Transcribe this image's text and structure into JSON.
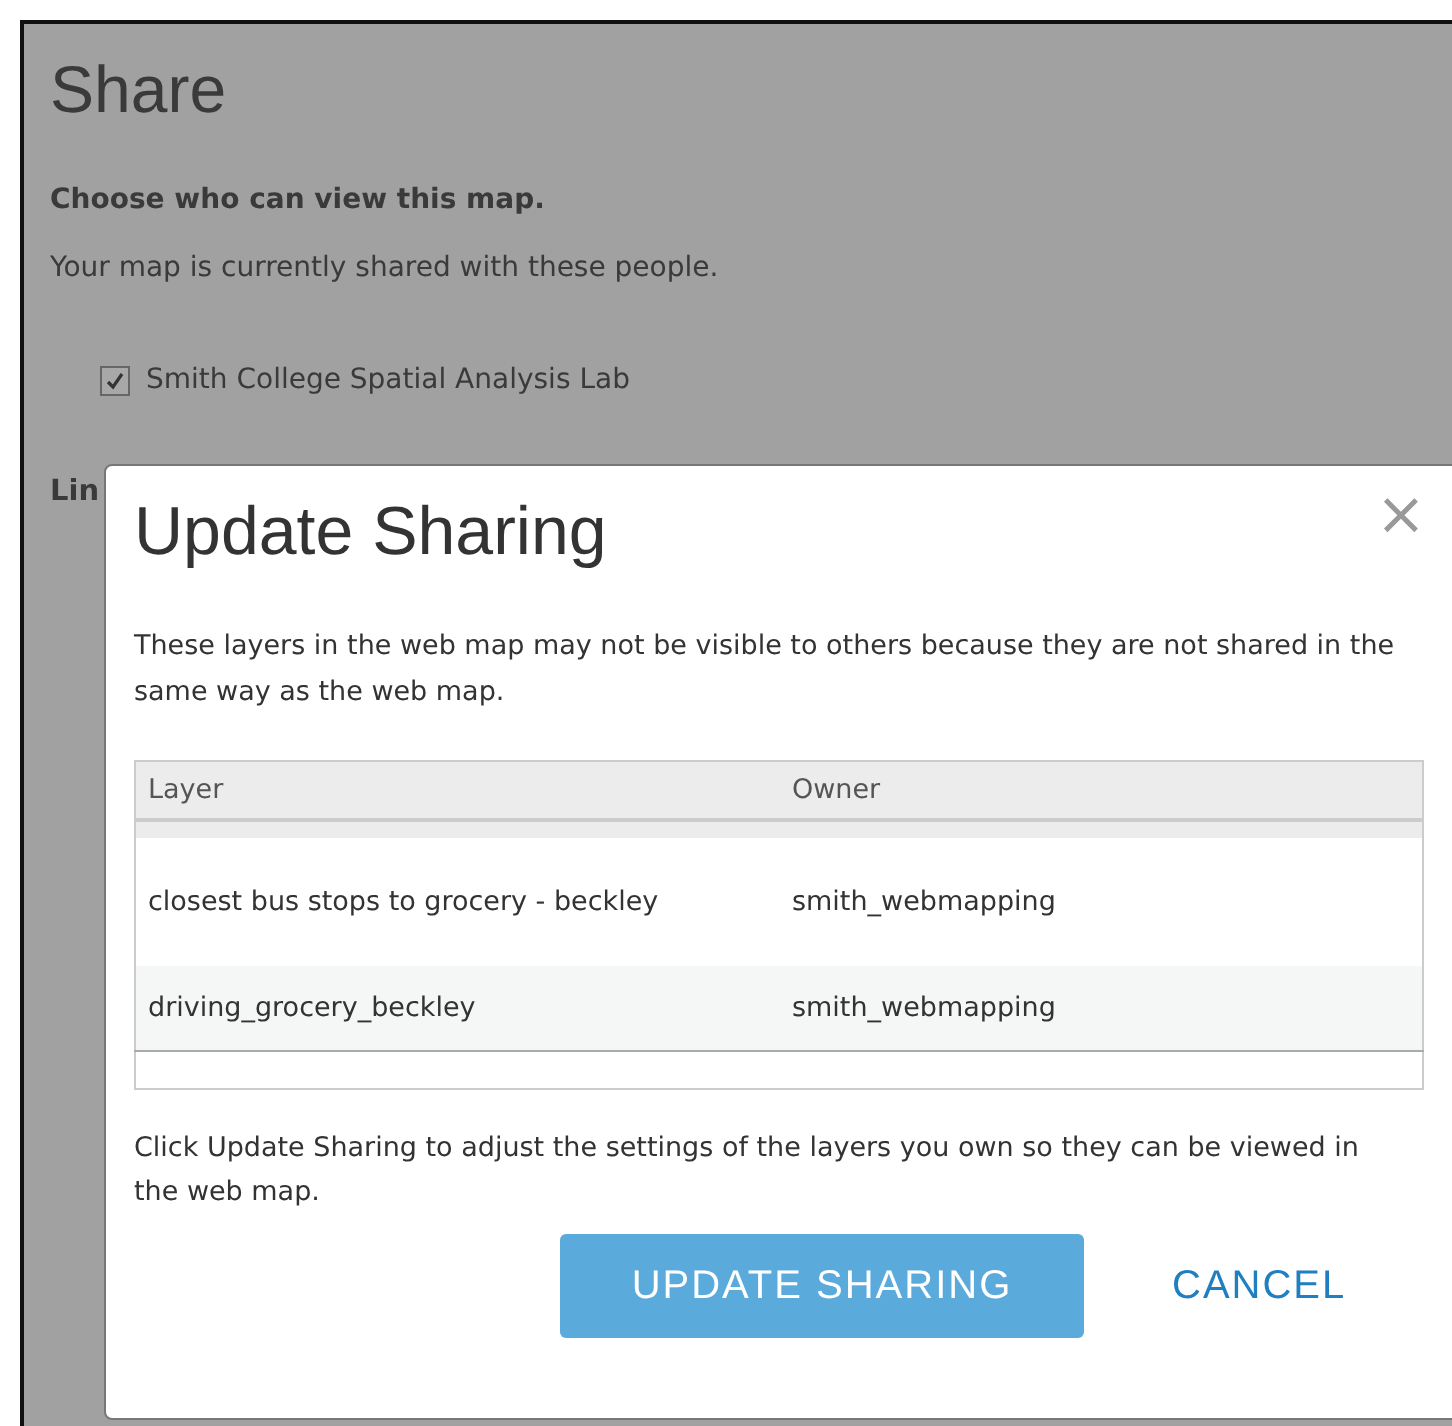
{
  "page": {
    "title": "Share",
    "heading": "Choose who can view this map.",
    "description": "Your map is currently shared with these people.",
    "groups": [
      {
        "label": "Smith College Spatial Analysis Lab",
        "checked": true
      }
    ],
    "section_heading": "Lin"
  },
  "dialog": {
    "title": "Update Sharing",
    "close": "×",
    "message": "These layers in the web map may not be visible to others because they are not shared in the same way as the web map.",
    "table": {
      "columns": [
        "Layer",
        "Owner"
      ],
      "rows": [
        [
          "closest bus stops to grocery - beckley",
          "smith_webmapping"
        ],
        [
          "driving_grocery_beckley",
          "smith_webmapping"
        ]
      ]
    },
    "note": "Click Update Sharing to adjust the settings of the layers you own so they can be viewed in the web map.",
    "buttons": [
      {
        "label": "UPDATE SHARING",
        "kind": "primary"
      },
      {
        "label": "CANCEL",
        "kind": "link"
      }
    ]
  }
}
